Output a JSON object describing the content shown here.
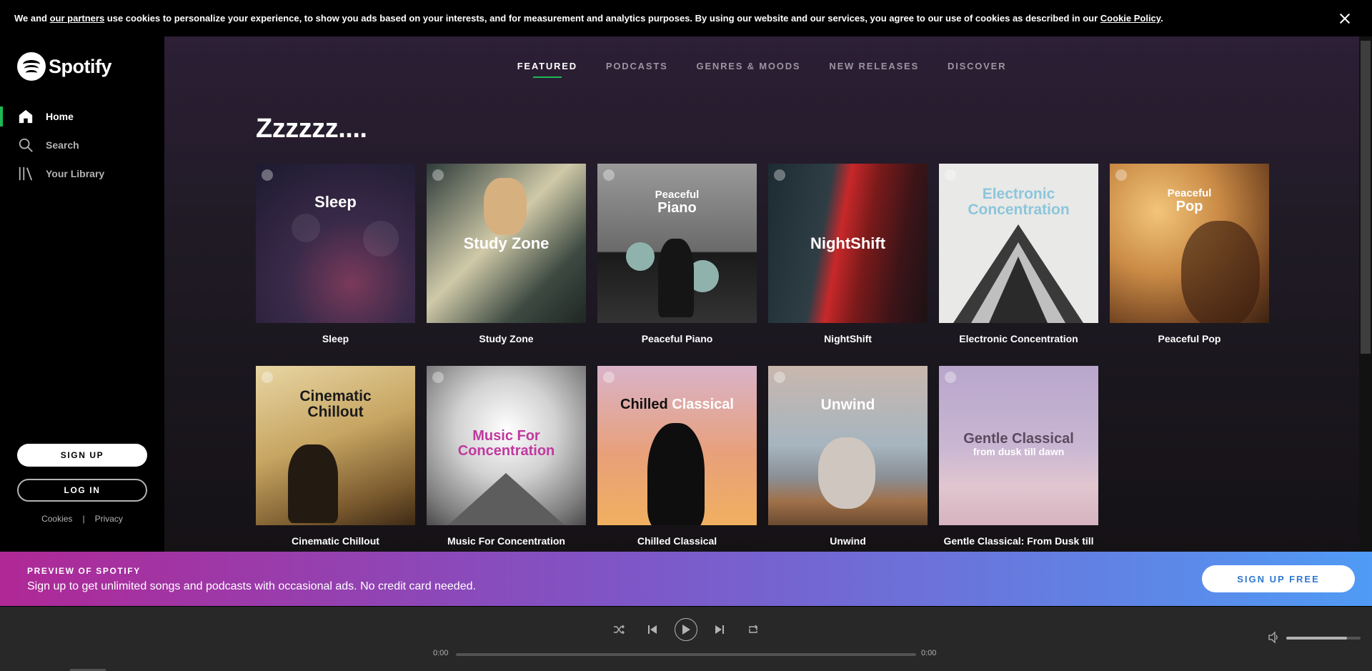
{
  "cookie_banner": {
    "text_1": "We and ",
    "partners_link": "our partners",
    "text_2": " use cookies to personalize your experience, to show you ads based on your interests, and for measurement and analytics purposes. By using our website and our services, you agree to our use of cookies as described in our ",
    "policy_link": "Cookie Policy",
    "text_3": "."
  },
  "sidebar": {
    "brand": "Spotify",
    "nav": [
      {
        "label": "Home",
        "icon": "home-icon",
        "active": true
      },
      {
        "label": "Search",
        "icon": "search-icon",
        "active": false
      },
      {
        "label": "Your Library",
        "icon": "library-icon",
        "active": false
      }
    ],
    "signup_label": "SIGN UP",
    "login_label": "LOG IN",
    "legal": {
      "cookies": "Cookies",
      "separator": "|",
      "privacy": "Privacy"
    }
  },
  "tabs": [
    {
      "label": "FEATURED",
      "active": true
    },
    {
      "label": "PODCASTS",
      "active": false
    },
    {
      "label": "GENRES & MOODS",
      "active": false
    },
    {
      "label": "NEW RELEASES",
      "active": false
    },
    {
      "label": "DISCOVER",
      "active": false
    }
  ],
  "section": {
    "title": "Zzzzzz....",
    "playlists": [
      {
        "title": "Sleep",
        "cover_line1": "",
        "cover_line2": "Sleep",
        "cover_color": "#ffffff"
      },
      {
        "title": "Study Zone",
        "cover_line1": "",
        "cover_line2": "Study Zone",
        "cover_color": "#ffffff"
      },
      {
        "title": "Peaceful Piano",
        "cover_line1": "Peaceful",
        "cover_line2": "Piano",
        "cover_color": "#ffffff"
      },
      {
        "title": "NightShift",
        "cover_line1": "",
        "cover_line2": "NightShift",
        "cover_color": "#ffffff"
      },
      {
        "title": "Electronic Concentration",
        "cover_line1": "Electronic",
        "cover_line2": "Concentration",
        "cover_color": "#8cc6dc"
      },
      {
        "title": "Peaceful Pop",
        "cover_line1": "Peaceful",
        "cover_line2": "Pop",
        "cover_color": "#ffffff"
      },
      {
        "title": "Cinematic Chillout",
        "cover_line1": "Cinematic",
        "cover_line2": "Chillout",
        "cover_color": "#1a1a1a"
      },
      {
        "title": "Music For Concentration",
        "cover_line1": "Music For",
        "cover_line2": "Concentration",
        "cover_color": "#c0399f"
      },
      {
        "title": "Chilled Classical",
        "cover_line1": "Chilled",
        "cover_line2": "Classical",
        "cover_color": "#111111"
      },
      {
        "title": "Unwind",
        "cover_line1": "",
        "cover_line2": "Unwind",
        "cover_color": "#ffffff"
      },
      {
        "title": "Gentle Classical: From Dusk till",
        "cover_line1": "Gentle Classical",
        "cover_line2": "from dusk till dawn",
        "cover_color": "#5a4a5e"
      }
    ]
  },
  "preview": {
    "kicker": "PREVIEW OF SPOTIFY",
    "message": "Sign up to get unlimited songs and podcasts with occasional ads. No credit card needed.",
    "cta": "SIGN UP FREE"
  },
  "player": {
    "elapsed": "0:00",
    "duration": "0:00",
    "progress": 0,
    "volume": 0.82,
    "icons": [
      "shuffle-icon",
      "previous-icon",
      "play-icon",
      "next-icon",
      "repeat-icon",
      "volume-icon"
    ]
  },
  "colors": {
    "accent": "#1db954",
    "banner_start": "#af2896",
    "banner_end": "#509bf5"
  }
}
